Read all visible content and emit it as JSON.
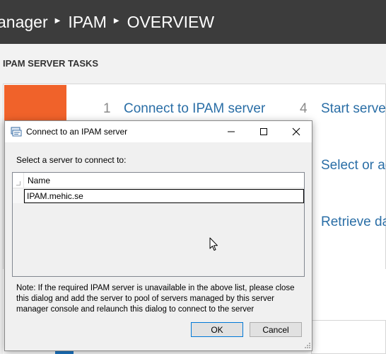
{
  "breadcrumb": {
    "items": [
      "anager",
      "IPAM",
      "OVERVIEW"
    ]
  },
  "main": {
    "section_title": "IPAM SERVER TASKS",
    "steps": [
      {
        "number": "1",
        "label": "Connect to IPAM server"
      },
      {
        "number": "4",
        "label": "Start server"
      }
    ],
    "links": [
      "Select or ad",
      "Retrieve dat"
    ]
  },
  "dialog": {
    "title": "Connect to an IPAM server",
    "prompt": "Select a server to connect to:",
    "list": {
      "columns": [
        "Name"
      ],
      "rows": [
        [
          "IPAM.mehic.se"
        ]
      ]
    },
    "note": "Note: If the required IPAM server is unavailable in the above list, please close this dialog and add the server to pool of servers managed by this server manager console and relaunch this dialog to connect to the server",
    "ok_label": "OK",
    "cancel_label": "Cancel"
  },
  "icons": {
    "title_separator": "caret-right-icon",
    "dialog_app": "server-manager-icon",
    "minimize": "minimize-icon",
    "maximize": "maximize-icon",
    "close": "close-icon",
    "cursor": "mouse-pointer-icon",
    "resize": "resize-grip-icon"
  },
  "colors": {
    "titlebar": "#3c3c3c",
    "accent_orange": "#f0622a",
    "link_blue": "#2a6ea6",
    "ok_border": "#0078d7"
  }
}
